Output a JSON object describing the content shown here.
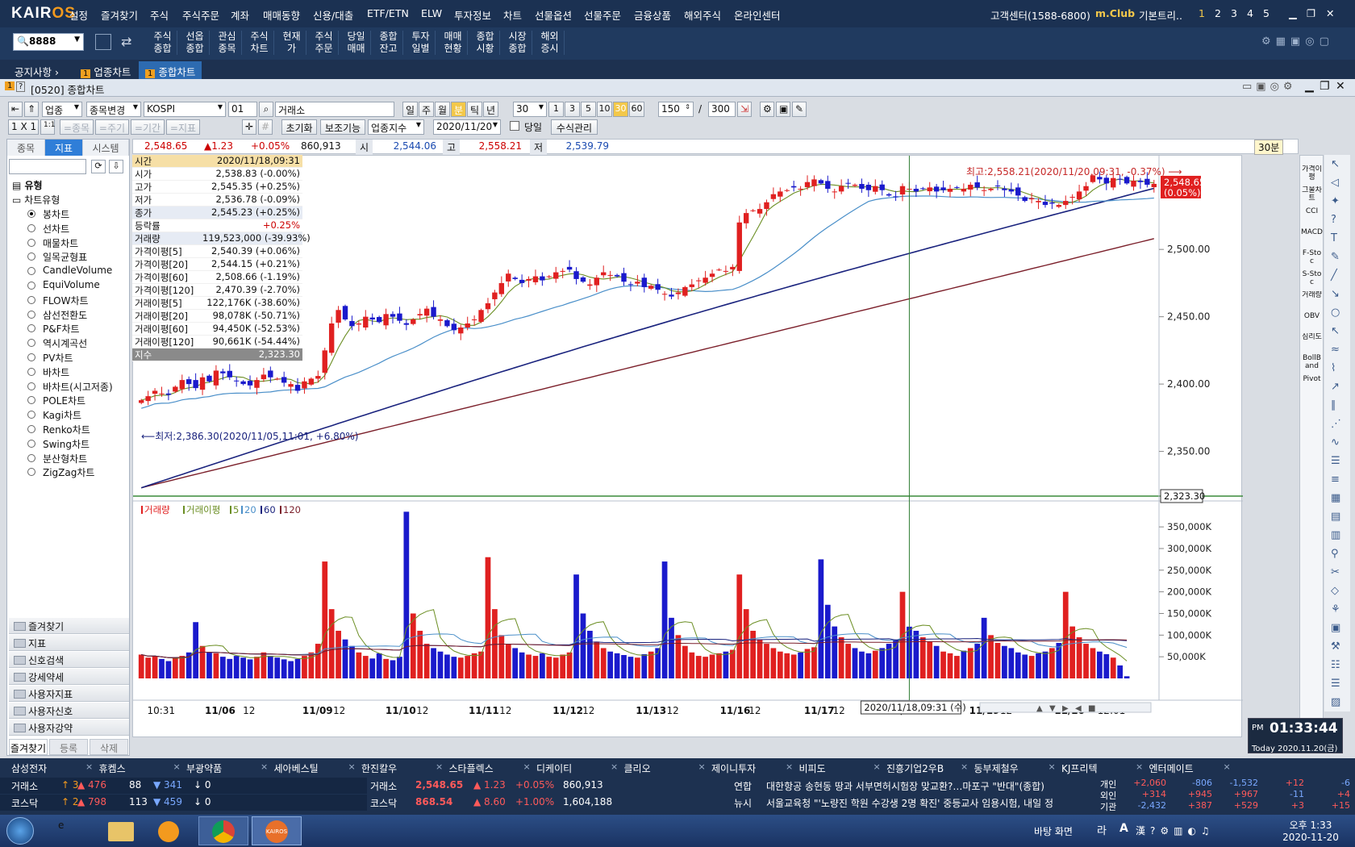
{
  "menubar": {
    "logo_a": "KAIR",
    "logo_b": "OS",
    "items": [
      "설정",
      "즐겨찾기",
      "주식",
      "주식주문",
      "계좌",
      "매매동향",
      "신용/대출",
      "ETF/ETN",
      "ELW",
      "투자정보",
      "차트",
      "선물옵션",
      "선물주문",
      "금융상품",
      "해외주식",
      "온라인센터"
    ],
    "support": "고객센터(1588-6800)",
    "club": "m.Club",
    "basic": "기본트리..",
    "workspaces": [
      "1",
      "2",
      "3",
      "4",
      "5"
    ]
  },
  "toolbar2": {
    "code_value": "8888",
    "buttons": [
      "주식\n종합",
      "선옵\n종합",
      "관심\n종목",
      "주식\n차트",
      "현재\n가",
      "주식\n주문",
      "당일\n매매",
      "종합\n잔고",
      "투자\n일별",
      "매매\n현황",
      "종합\n시황",
      "시장\n종합",
      "해외\n증시"
    ]
  },
  "tabs": {
    "notice": "공지사항",
    "items": [
      {
        "num": "1",
        "label": "업종차트",
        "active": false
      },
      {
        "num": "1",
        "label": "종합차트",
        "active": true
      }
    ]
  },
  "window": {
    "title": "[0520] 종합차트"
  },
  "controls": {
    "market_select": "업종",
    "change_select": "종목변경",
    "index_name": "KOSPI",
    "index_code": "01",
    "exchange": "거래소",
    "periods": [
      "일",
      "주",
      "월",
      "분",
      "틱",
      "년"
    ],
    "active_period": "분",
    "minute_select": "30",
    "minutes": [
      "1",
      "3",
      "5",
      "10",
      "30",
      "60"
    ],
    "active_minute": "30",
    "count": "150",
    "total": "300",
    "reset": "초기화",
    "aux": "보조기능",
    "index_select": "업종지수",
    "date": "2020/11/20",
    "today_label": "당일",
    "formula": "수식관리",
    "layout": "1 X 1",
    "dis_buttons": [
      "=종목",
      "=주기",
      "=기간",
      "=지표"
    ]
  },
  "quote": {
    "price": "2,548.65",
    "change": "▲1.23",
    "pct": "+0.05%",
    "volume": "860,913",
    "open_label": "시",
    "open": "2,544.06",
    "high_label": "고",
    "high": "2,558.21",
    "low_label": "저",
    "low": "2,539.79",
    "interval": "30분"
  },
  "left_panel": {
    "tabs": [
      "종목",
      "지표",
      "시스템"
    ],
    "active_tab": "지표",
    "type_label": "유형",
    "chart_type_label": "차트유형",
    "chart_types": [
      "봉차트",
      "선차트",
      "매물차트",
      "일목균형표",
      "CandleVolume",
      "EquiVolume",
      "FLOW차트",
      "삼선전환도",
      "P&F차트",
      "역시계곡선",
      "PV차트",
      "바차트",
      "바차트(시고저종)",
      "POLE차트",
      "Kagi차트",
      "Renko차트",
      "Swing차트",
      "분산형차트",
      "ZigZag차트"
    ],
    "selected": "봉차트",
    "folders": [
      "즐겨찾기",
      "지표",
      "신호검색",
      "강세약세",
      "사용자지표",
      "사용자신호",
      "사용자강약"
    ],
    "bottom_tabs": [
      "즐겨찾기",
      "등록",
      "삭제"
    ]
  },
  "info_box": [
    {
      "k": "시간",
      "v": "2020/11/18,09:31"
    },
    {
      "k": "시가",
      "v": "2,538.83 (-0.00%)"
    },
    {
      "k": "고가",
      "v": "2,545.35 (+0.25%)"
    },
    {
      "k": "저가",
      "v": "2,536.78 (-0.09%)"
    },
    {
      "k": "종가",
      "v": "2,545.23 (+0.25%)"
    },
    {
      "k": "등락률",
      "v": "+0.25%"
    },
    {
      "k": "거래량",
      "v": "119,523,000 (-39.93%)"
    },
    {
      "k": "가격이평[5]",
      "v": "2,540.39 (+0.06%)"
    },
    {
      "k": "가격이평[20]",
      "v": "2,544.15 (+0.21%)"
    },
    {
      "k": "가격이평[60]",
      "v": "2,508.66 (-1.19%)"
    },
    {
      "k": "가격이평[120]",
      "v": "2,470.39 (-2.70%)"
    },
    {
      "k": "거래이평[5]",
      "v": "122,176K (-38.60%)"
    },
    {
      "k": "거래이평[20]",
      "v": "98,078K (-50.71%)"
    },
    {
      "k": "거래이평[60]",
      "v": "94,450K (-52.53%)"
    },
    {
      "k": "거래이평[120]",
      "v": "90,661K (-54.44%)"
    },
    {
      "k": "지수",
      "v": "2,323.30"
    }
  ],
  "annotations": {
    "high": "최고:2,558.21(2020/11/20,09:31, -0.37%)",
    "low": "최저:2,386.30(2020/11/05,11:01, +6.80%)",
    "last_price": "2,548.65",
    "last_pct": "(0.05%)",
    "cross_price": "2,323.30",
    "cross_date": "2020/11/18,09:31 (수)"
  },
  "volume_legend": [
    "거래량",
    "거래이평",
    "5",
    "20",
    "60",
    "120"
  ],
  "right_rail": [
    "가격이평",
    "그물차트",
    "CCI",
    "MACD",
    "F-Stoc",
    "S-Stoc",
    "거래량",
    "OBV",
    "심리도",
    "BollBand",
    "Pivot"
  ],
  "clock": {
    "ampm": "PM",
    "time": "01:33:44",
    "today": "Today 2020.11.20(금)"
  },
  "bottom": {
    "watch": [
      "삼성전자",
      "휴켐스",
      "부광약품",
      "세아베스틸",
      "한진칼우",
      "스타플렉스",
      "디케이티",
      "클리오",
      "제이니투자",
      "비피도",
      "진흥기업2우B",
      "동부제철우",
      "KJ프리텍",
      "엔터메이트"
    ],
    "markets": [
      {
        "name": "거래소",
        "up": "↑ 3",
        "r1": "▲ 476",
        "n": "88",
        "d1": "▼ 341",
        "z": "↓ 0"
      },
      {
        "name": "코스닥",
        "up": "↑ 2",
        "r1": "▲ 798",
        "n": "113",
        "d1": "▼ 459",
        "z": "↓ 0"
      }
    ],
    "idx": [
      {
        "name": "거래소",
        "val": "2,548.65",
        "ch": "▲ 1.23",
        "pct": "+0.05%",
        "vol": "860,913"
      },
      {
        "name": "코스닥",
        "val": "868.54",
        "ch": "▲ 8.60",
        "pct": "+1.00%",
        "vol": "1,604,188"
      }
    ],
    "news": [
      {
        "src": "연합",
        "text": "대한항공 송현동 땅과 서부면허시험장 맞교환?…마포구 \"반대\"(종합)"
      },
      {
        "src": "뉴시",
        "text": "서울교육청 \"'노량진 학원 수강생 2명 확진' 중등교사 임용시험, 내일 정"
      }
    ],
    "investors": [
      {
        "name": "개인",
        "v": [
          "+2,060",
          "-806",
          "-1,532",
          "+12",
          "-6"
        ]
      },
      {
        "name": "외인",
        "v": [
          "+314",
          "+945",
          "+967",
          "-11",
          "+4"
        ]
      },
      {
        "name": "기관",
        "v": [
          "-2,432",
          "+387",
          "+529",
          "+3",
          "+15"
        ]
      }
    ]
  },
  "taskbar": {
    "desktop": "바탕 화면",
    "ime": "라",
    "ime2": "A",
    "time": "오후 1:33",
    "date": "2020-11-20",
    "kairos": "KAIROS"
  },
  "chart_data": {
    "type": "candlestick",
    "interval": "30분",
    "x_labels": [
      "10:31",
      "11/06",
      "12",
      "11/09",
      "12",
      "11/10",
      "12",
      "11/11",
      "12",
      "11/12",
      "12",
      "11/13",
      "12",
      "11/16",
      "12",
      "11/17",
      "12",
      "11/18",
      "12",
      "11/19",
      "12",
      "11/20",
      "12:01"
    ],
    "price_axis": [
      2350,
      2400,
      2450,
      2500
    ],
    "price_axis_labels": [
      "2,350.00",
      "2,400.00",
      "2,450.00",
      "2,500.00"
    ],
    "price_ylim": [
      2318,
      2566
    ],
    "volume_axis_labels": [
      "50,000K",
      "100,000K",
      "150,000K",
      "200,000K",
      "250,000K",
      "300,000K",
      "350,000K"
    ],
    "volume_ylim": [
      0,
      395000
    ],
    "close": [
      2388,
      2391,
      2395,
      2393,
      2392,
      2398,
      2403,
      2400,
      2397,
      2405,
      2402,
      2410,
      2408,
      2405,
      2402,
      2400,
      2399,
      2403,
      2407,
      2405,
      2404,
      2401,
      2400,
      2395,
      2402,
      2404,
      2406,
      2425,
      2445,
      2455,
      2448,
      2443,
      2445,
      2450,
      2448,
      2446,
      2452,
      2450,
      2447,
      2444,
      2448,
      2452,
      2456,
      2450,
      2448,
      2443,
      2440,
      2442,
      2445,
      2448,
      2455,
      2460,
      2468,
      2475,
      2482,
      2478,
      2475,
      2478,
      2480,
      2477,
      2480,
      2483,
      2484,
      2485,
      2478,
      2476,
      2474,
      2479,
      2483,
      2481,
      2480,
      2476,
      2474,
      2476,
      2472,
      2473,
      2470,
      2467,
      2465,
      2468,
      2472,
      2474,
      2477,
      2479,
      2482,
      2485,
      2484,
      2487,
      2520,
      2527,
      2529,
      2530,
      2535,
      2541,
      2543,
      2544,
      2546,
      2545,
      2550,
      2552,
      2549,
      2545,
      2543,
      2547,
      2549,
      2548,
      2545,
      2544,
      2547,
      2544,
      2540,
      2539,
      2547,
      2545,
      2543,
      2545,
      2546,
      2543,
      2544,
      2545,
      2546,
      2545,
      2548,
      2546,
      2544,
      2545,
      2547,
      2544,
      2543,
      2540,
      2536,
      2538,
      2536,
      2533,
      2534,
      2533,
      2536,
      2539,
      2543,
      2547,
      2555,
      2552,
      2549,
      2553,
      2552,
      2549,
      2551,
      2550,
      2548,
      2548.65
    ],
    "volume_k": [
      55000,
      48000,
      52000,
      45000,
      40000,
      48000,
      52000,
      60000,
      130000,
      75000,
      60000,
      58000,
      50000,
      45000,
      52000,
      48000,
      44000,
      50000,
      60000,
      52000,
      48000,
      44000,
      40000,
      45000,
      52000,
      60000,
      80000,
      270000,
      160000,
      110000,
      90000,
      75000,
      60000,
      52000,
      46000,
      58000,
      45000,
      42000,
      50000,
      385000,
      150000,
      110000,
      80000,
      70000,
      62000,
      55000,
      50000,
      48000,
      52000,
      58000,
      62000,
      280000,
      160000,
      100000,
      80000,
      70000,
      60000,
      55000,
      52000,
      58000,
      50000,
      48000,
      55000,
      60000,
      240000,
      150000,
      110000,
      85000,
      70000,
      62000,
      58000,
      54000,
      50000,
      48000,
      56000,
      62000,
      70000,
      270000,
      140000,
      100000,
      75000,
      60000,
      52000,
      50000,
      55000,
      58000,
      62000,
      66000,
      240000,
      160000,
      110000,
      90000,
      80000,
      70000,
      62000,
      58000,
      55000,
      60000,
      68000,
      72000,
      275000,
      170000,
      120000,
      95000,
      80000,
      70000,
      62000,
      58000,
      64000,
      70000,
      80000,
      90000,
      200000,
      119523,
      110000,
      95000,
      85000,
      75000,
      62000,
      58000,
      52000,
      64000,
      70000,
      80000,
      140000,
      100000,
      82000,
      75000,
      70000,
      60000,
      55000,
      52000,
      58000,
      62000,
      70000,
      82000,
      200000,
      120000,
      95000,
      80000,
      70000,
      62000,
      56000,
      48000,
      30000,
      5000
    ],
    "ma_price": {
      "5": "olive",
      "20": "steelblue",
      "60": "navy",
      "120": "maroon"
    },
    "crosshair": "2020/11/18,09:31"
  }
}
